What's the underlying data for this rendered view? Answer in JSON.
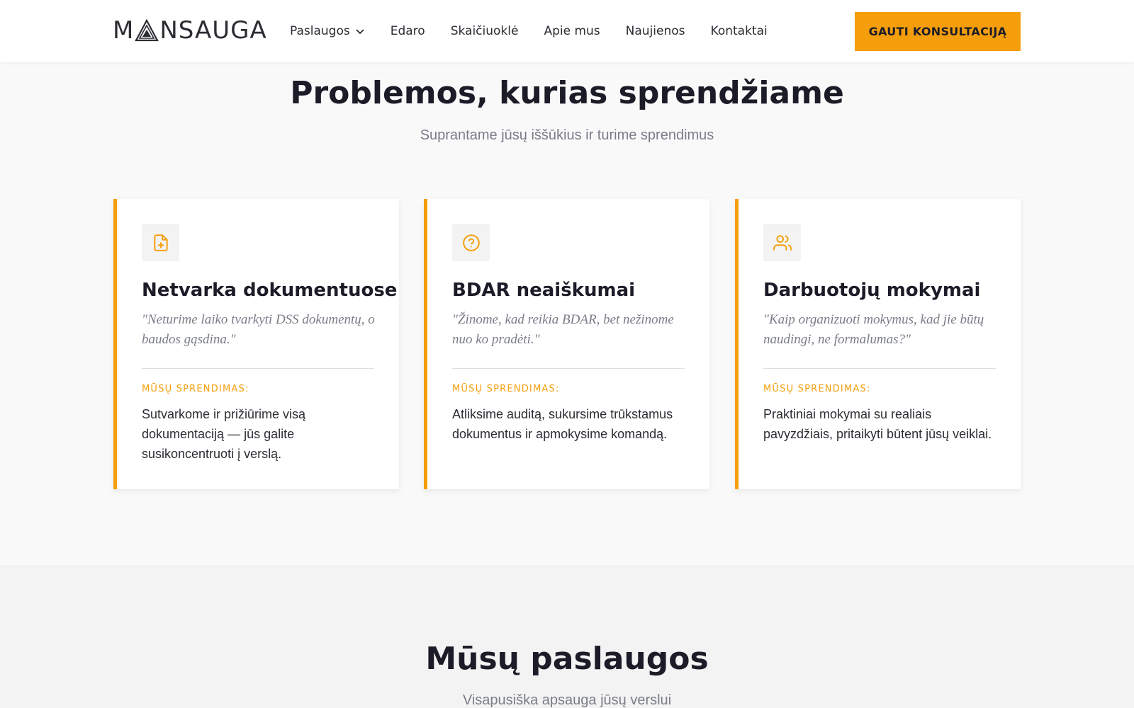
{
  "header": {
    "logo_text_pre": "M",
    "logo_text_post": "NSAUGA",
    "nav": [
      {
        "label": "Paslaugos"
      },
      {
        "label": "Edaro"
      },
      {
        "label": "Skaičiuoklė"
      },
      {
        "label": "Apie mus"
      },
      {
        "label": "Naujienos"
      },
      {
        "label": "Kontaktai"
      }
    ],
    "cta_label": "GAUTI KONSULTACIJĄ"
  },
  "problems": {
    "title": "Problemos, kurias sprendžiame",
    "subtitle": "Suprantame jūsų iššūkius ir turime sprendimus",
    "cards": [
      {
        "icon": "file-plus-icon",
        "title": "Netvarka dokumentuose",
        "quote": "\"Neturime laiko tvarkyti DSS dokumentų, o baudos gąsdina.\"",
        "solution_label": "MŪSŲ SPRENDIMAS:",
        "solution": "Sutvarkome ir prižiūrime visą dokumentaciją — jūs galite susikoncentruoti į verslą."
      },
      {
        "icon": "question-circle-icon",
        "title": "BDAR neaiškumai",
        "quote": "\"Žinome, kad reikia BDAR, bet nežinome nuo ko pradėti.\"",
        "solution_label": "MŪSŲ SPRENDIMAS:",
        "solution": "Atliksime auditą, sukursime trūkstamus dokumentus ir apmokysime komandą."
      },
      {
        "icon": "users-icon",
        "title": "Darbuotojų mokymai",
        "quote": "\"Kaip organizuoti mokymus, kad jie būtų naudingi, ne formalumas?\"",
        "solution_label": "MŪSŲ SPRENDIMAS:",
        "solution": "Praktiniai mokymai su realiais pavyzdžiais, pritaikyti būtent jūsų veiklai."
      }
    ]
  },
  "services": {
    "title": "Mūsų paslaugos",
    "subtitle": "Visapusiška apsauga jūsų verslui"
  },
  "colors": {
    "accent": "#f59e0b",
    "text_dark": "#1c1c28",
    "text_muted": "#7a7d87",
    "page_bg": "#f9f9fa",
    "section_bg": "#f3f3f4"
  }
}
